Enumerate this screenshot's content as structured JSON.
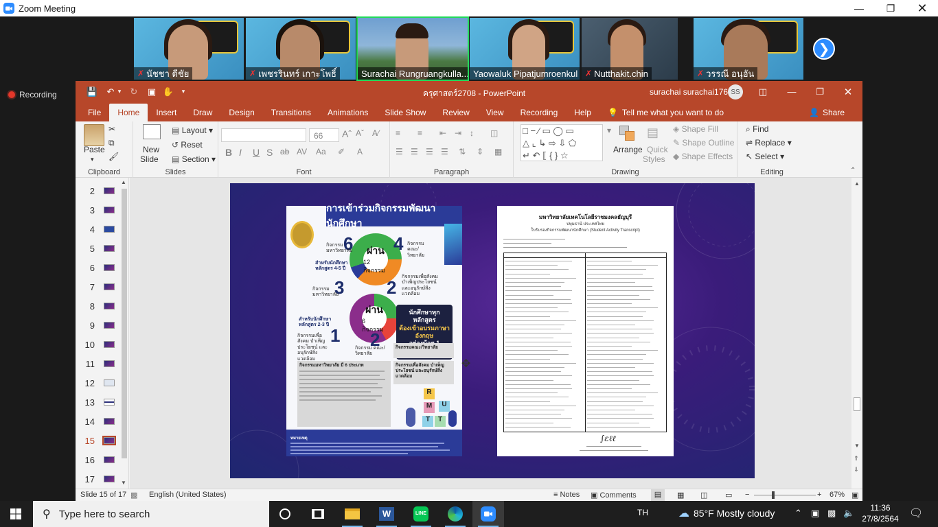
{
  "zoom": {
    "window_title": "Zoom Meeting",
    "recording_label": "Recording",
    "participants": [
      {
        "name": "นัชชา ดีชัย",
        "muted": true
      },
      {
        "name": "เพชรรินทร์ เกาะโพธิ์",
        "muted": true
      },
      {
        "name": "Surachai Rungruangkulla...",
        "muted": false,
        "active": true
      },
      {
        "name": "Yaowaluk Pipatjumroenkul",
        "muted": false
      },
      {
        "name": "Nutthakit.chin",
        "muted": true
      },
      {
        "name": "วรรณี อนุอัน",
        "muted": true
      }
    ]
  },
  "ppt": {
    "doc_title": "ครุศาสตร์2708  -  PowerPoint",
    "user_name": "surachai surachai1769",
    "user_initials": "SS",
    "tabs": [
      "File",
      "Home",
      "Insert",
      "Draw",
      "Design",
      "Transitions",
      "Animations",
      "Slide Show",
      "Review",
      "View",
      "Recording",
      "Help"
    ],
    "tell_me": "Tell me what you want to do",
    "share": "Share",
    "ribbon": {
      "paste": "Paste",
      "clipboard": "Clipboard",
      "new_slide_1": "New",
      "new_slide_2": "Slide",
      "layout": "Layout",
      "reset": "Reset",
      "section": "Section",
      "slides": "Slides",
      "font_size": "66",
      "font": "Font",
      "paragraph": "Paragraph",
      "arrange": "Arrange",
      "quick_styles_1": "Quick",
      "quick_styles_2": "Styles",
      "shape_fill": "Shape Fill",
      "shape_outline": "Shape Outline",
      "shape_effects": "Shape Effects",
      "drawing": "Drawing",
      "find": "Find",
      "replace": "Replace",
      "select": "Select",
      "editing": "Editing"
    },
    "slide_numbers": [
      "2",
      "3",
      "4",
      "5",
      "6",
      "7",
      "8",
      "9",
      "10",
      "11",
      "12",
      "13",
      "14",
      "15",
      "16",
      "17"
    ],
    "current_slide": "15",
    "status": {
      "slide_of": "Slide 15 of 17",
      "language": "English (United States)",
      "notes": "Notes",
      "comments": "Comments",
      "zoom": "67%"
    },
    "poster": {
      "heading": "การเข้าร่วมกิจกรรมพัฒนานักศึกษา",
      "donut1_top": "ผ่าน",
      "donut1_bottom": "12 กิจกรรม",
      "donut2_top": "ผ่าน",
      "donut2_bottom": "6 กิจกรรม",
      "n6": "6",
      "n4": "4",
      "n3": "3",
      "n2a": "2",
      "n1": "1",
      "n2b": "2",
      "lbl_univ": "กิจกรรม มหาวิทยาลัย",
      "lbl_faculty": "กิจกรรม คณะ/วิทยาลัย",
      "lbl_course1": "สำหรับนักศึกษา หลักสูตร 4-5 ปี",
      "lbl_social": "กิจกรรมเพื่อสังคม บำเพ็ญประโยชน์ และอนุรักษ์สิ่งแวดล้อม",
      "lbl_course2": "สำหรับนักศึกษา หลักสูตร 2-3 ปี",
      "dark_1": "นักศึกษาทุกหลักสูตร",
      "dark_2": "ต้องเข้าอบรมภาษาอังกฤษ",
      "dark_3": "อย่างน้อย 1 หลักสูตร",
      "box_univ": "กิจกรรมมหาวิทยาลัย มี 6 ประเภท",
      "box_faculty": "กิจกรรมคณะ/วิทยาลัย",
      "box_social": "กิจกรรมเพื่อสังคม บำเพ็ญประโยชน์ และอนุรักษ์สิ่งแวดล้อม",
      "note": "หมายเหตุ"
    },
    "transcript": {
      "uni": "มหาวิทยาลัยเทคโนโลยีราชมงคลธัญบุรี",
      "place": "ปทุมธานี ประเทศไทย",
      "title": "ใบรับรองกิจกรรมพัฒนานักศึกษา (Student Activity Transcript)"
    }
  },
  "taskbar": {
    "search_placeholder": "Type here to search",
    "lang": "TH",
    "weather": "85°F  Mostly cloudy",
    "time": "11:36",
    "date": "27/8/2564"
  },
  "colors": {
    "ppt_accent": "#b7472a",
    "zoom_blue": "#2D8CFF",
    "active_speaker": "#23d959",
    "slide_bg": "#3a1c7a"
  }
}
